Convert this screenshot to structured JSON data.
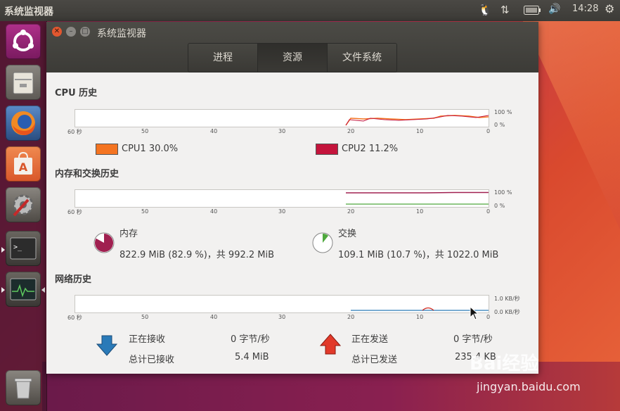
{
  "topbar": {
    "title": "系统监视器",
    "time": "14:28"
  },
  "window": {
    "title": "系统监视器",
    "tabs": [
      {
        "label": "进程"
      },
      {
        "label": "资源"
      },
      {
        "label": "文件系统"
      }
    ]
  },
  "cpu": {
    "section_title": "CPU 历史",
    "ticks": [
      "60 秒",
      "50",
      "40",
      "30",
      "20",
      "10",
      "0"
    ],
    "y_max": "100 %",
    "y_min": "0 %",
    "cpus": [
      {
        "label": "CPU1  30.0%",
        "color": "#f47421"
      },
      {
        "label": "CPU2  11.2%",
        "color": "#c4143c"
      }
    ]
  },
  "memory": {
    "section_title": "内存和交换历史",
    "ticks": [
      "60 秒",
      "50",
      "40",
      "30",
      "20",
      "10",
      "0"
    ],
    "y_max": "100 %",
    "y_min": "0 %",
    "mem_label": "内存",
    "mem_value": "822.9 MiB (82.9 %)，共 992.2 MiB",
    "mem_fraction": 0.829,
    "mem_color": "#a02050",
    "swap_label": "交换",
    "swap_value": "109.1 MiB (10.7 %)，共 1022.0 MiB",
    "swap_fraction": 0.107,
    "swap_color": "#4ea83d"
  },
  "network": {
    "section_title": "网络历史",
    "ticks": [
      "60 秒",
      "50",
      "40",
      "30",
      "20",
      "10",
      "0"
    ],
    "y_max": "1.0 KB/秒",
    "y_min": "0.0 KB/秒",
    "recv_label": "正在接收",
    "recv_rate": "0 字节/秒",
    "recv_total_label": "总计已接收",
    "recv_total": "5.4 MiB",
    "send_label": "正在发送",
    "send_rate": "0 字节/秒",
    "send_total_label": "总计已发送",
    "send_total": "235.4 KB",
    "recv_color": "#2a7ab8",
    "send_color": "#d22a1e"
  },
  "watermark": {
    "site": "jingyan.baidu.com",
    "brand": "Bai经验"
  }
}
